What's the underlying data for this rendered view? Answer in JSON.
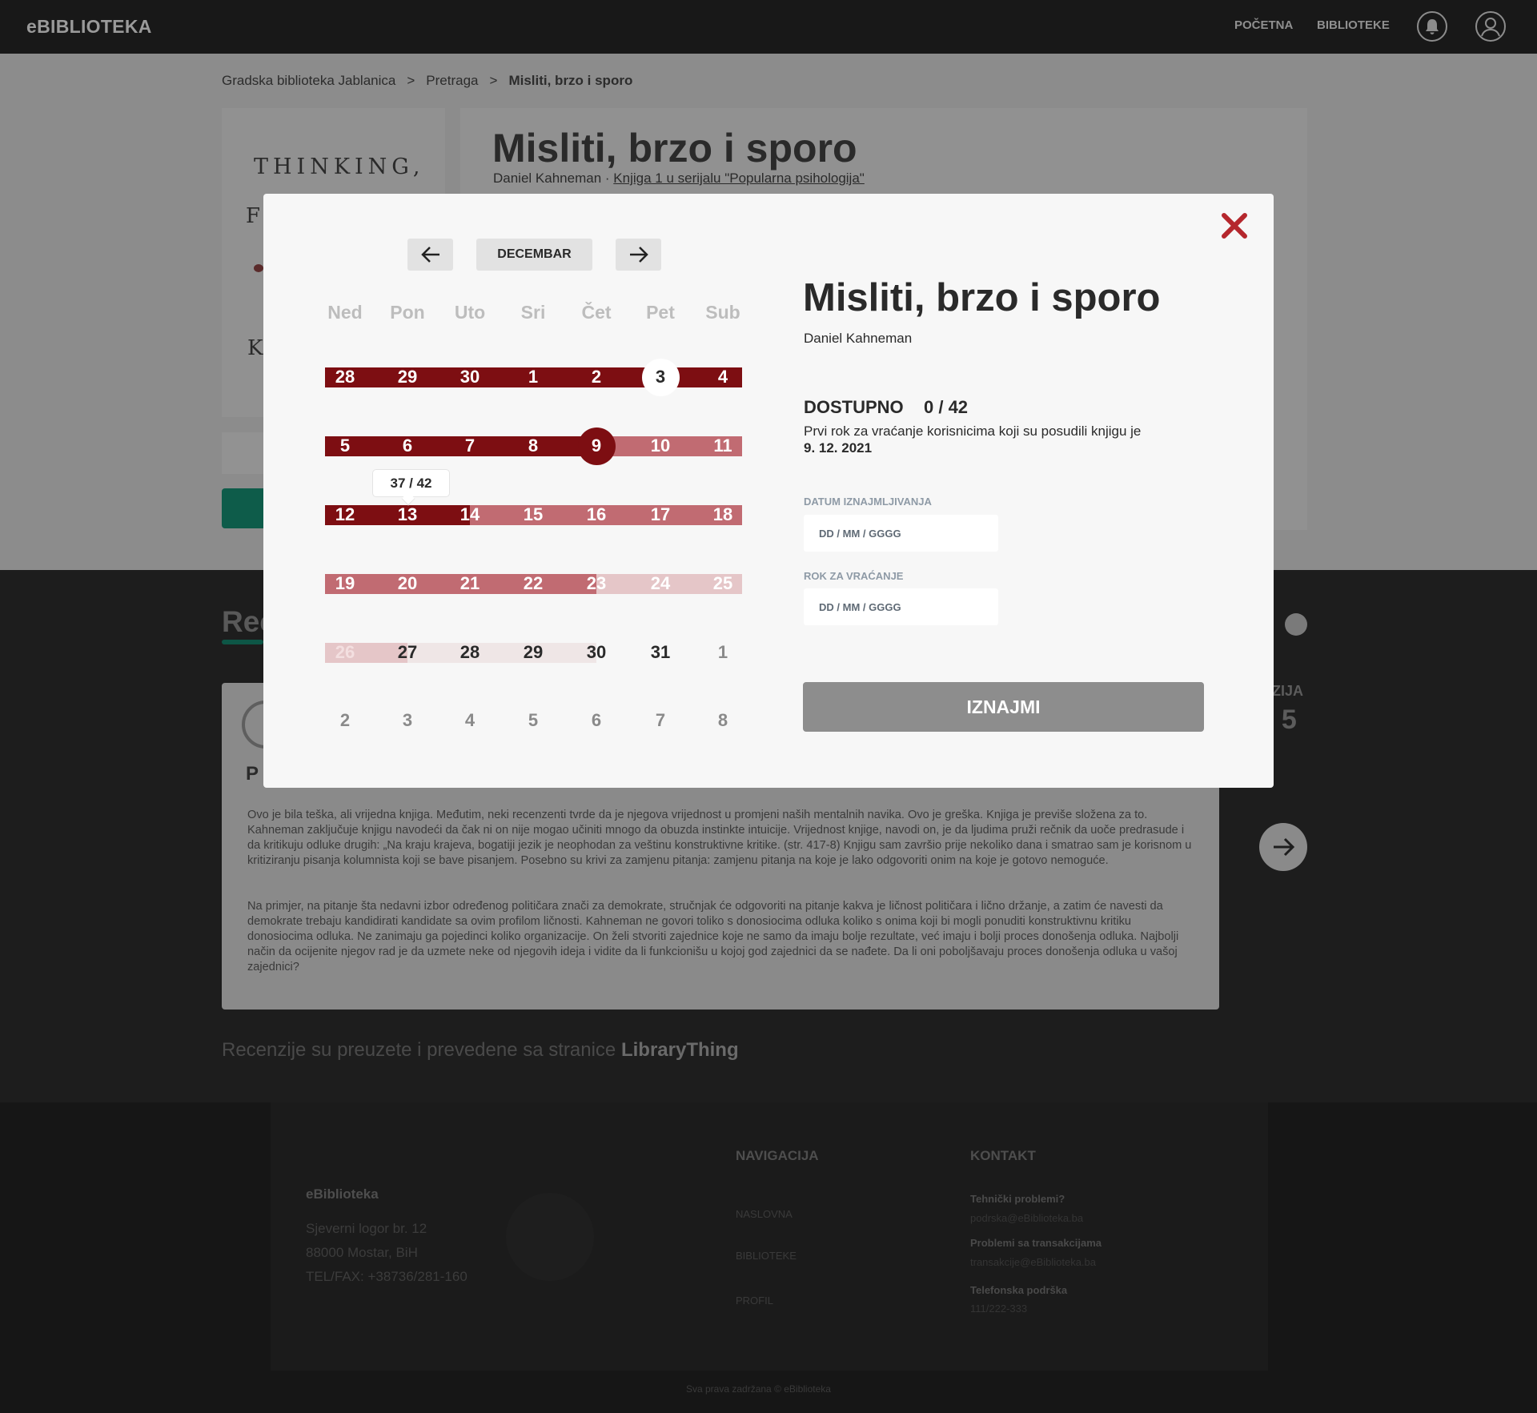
{
  "header": {
    "logo": "eBIBLIOTEKA",
    "nav": [
      "POČETNA",
      "BIBLIOTEKE"
    ],
    "icons": [
      "bell-icon",
      "user-icon"
    ]
  },
  "breadcrumb": [
    "Gradska biblioteka Jablanica",
    "Pretraga",
    "Misliti, brzo i sporo"
  ],
  "book": {
    "title": "Misliti, brzo i sporo",
    "author": "Daniel Kahneman",
    "series_link": "Knjiga 1 u serijalu \"Popularna psihologija\"",
    "cover_title": "THINKING,",
    "cover_f": "F",
    "cover_k": "K"
  },
  "reviews": {
    "heading": "Rec",
    "reviewer_initial": "P",
    "rating_label": "ZIJA",
    "rating_value": "/ 5",
    "paragraph1": "Ovo je bila teška, ali vrijedna knjiga. Međutim, neki recenzenti tvrde da je njegova vrijednost u promjeni naših mentalnih navika. Ovo je greška. Knjiga je previše složena za to. Kahneman zaključuje knjigu navodeći da čak ni on nije mogao učiniti mnogo da obuzda instinkte intuicije. Vrijednost knjige, navodi on, je da ljudima pruži rečnik da uoče predrasude i da kritikuju odluke drugih: „Na kraju krajeva, bogatiji jezik je neophodan za veštinu konstruktivne kritike. (str. 417-8) Knjigu sam završio prije nekoliko dana i smatrao sam je korisnom u kritiziranju pisanja kolumnista koji se bave pisanjem. Posebno su krivi za zamjenu pitanja: zamjenu pitanja na koje je lako odgovoriti onim na koje je gotovo nemoguće.",
    "paragraph2": "Na primjer, na pitanje šta nedavni izbor određenog političara znači za demokrate, stručnjak će odgovoriti na pitanje kakva je ličnost političara i lično držanje, a zatim će navesti da demokrate trebaju kandidirati kandidate sa ovim profilom ličnosti. Kahneman ne govori toliko s donosiocima odluka koliko s onima koji bi mogli ponuditi konstruktivnu kritiku donosiocima odluka. Ne zanimaju ga pojedinci koliko organizacije. On želi stvoriti zajednice koje ne samo da imaju bolje rezultate, već imaju i bolji proces donošenja odluka. Najbolji način da ocijenite njegov rad je da uzmete neke od njegovih ideja i vidite da li funkcionišu u kojoj god zajednici da se nađete. Da li oni poboljšavaju proces donošenja odluka u vašoj zajednici?",
    "credits_prefix": "Recenzije su preuzete i prevedene sa stranice",
    "credits_source": "LibraryThing"
  },
  "footer": {
    "brand": "eBiblioteka",
    "address": [
      "Sjeverni logor br. 12",
      "88000 Mostar, BiH",
      "TEL/FAX: +38736/281-160"
    ],
    "nav_title": "NAVIGACIJA",
    "nav_items": [
      "NASLOVNA",
      "BIBLIOTEKE",
      "PROFIL"
    ],
    "contact_title": "KONTAKT",
    "contacts": [
      {
        "label": "Tehnički problemi?",
        "value": "podrska@eBiblioteka.ba"
      },
      {
        "label": "Problemi sa transakcijama",
        "value": "transakcije@eBiblioteka.ba"
      },
      {
        "label": "Telefonska podrška",
        "value": "111/222-333"
      }
    ],
    "copyright": "Sva prava zadržana © eBiblioteka"
  },
  "modal": {
    "close_icon": "close-icon",
    "month": "DECEMBAR",
    "weekdays": [
      "Ned",
      "Pon",
      "Uto",
      "Sri",
      "Čet",
      "Pet",
      "Sub"
    ],
    "weeks": [
      [
        "28",
        "29",
        "30",
        "1",
        "2",
        "3",
        "4"
      ],
      [
        "5",
        "6",
        "7",
        "8",
        "9",
        "10",
        "11"
      ],
      [
        "12",
        "13",
        "14",
        "15",
        "16",
        "17",
        "18"
      ],
      [
        "19",
        "20",
        "21",
        "22",
        "23",
        "24",
        "25"
      ],
      [
        "26",
        "27",
        "28",
        "29",
        "30",
        "31",
        "1"
      ],
      [
        "2",
        "3",
        "4",
        "5",
        "6",
        "7",
        "8"
      ]
    ],
    "today": "3",
    "first_return_day": "9",
    "tooltip": "37 / 42",
    "title": "Misliti, brzo i sporo",
    "author": "Daniel Kahneman",
    "available_label": "DOSTUPNO",
    "available_value": "0 / 42",
    "return_note": "Prvi rok za vraćanje korisnicima koji su posudili knjigu je",
    "return_date": "9. 12. 2021",
    "rent_date_label": "DATUM IZNAJMLJIVANJA",
    "rent_date_placeholder": "DD / MM / GGGG",
    "return_label": "ROK ZA VRAĆANJE",
    "return_placeholder": "DD / MM / GGGG",
    "rent_button": "IZNAJMI",
    "colors": {
      "dark_red": "#7d0e12",
      "mid_red": "#c16b72",
      "light_red": "#e5c6c8",
      "close_red": "#b5272d"
    }
  }
}
